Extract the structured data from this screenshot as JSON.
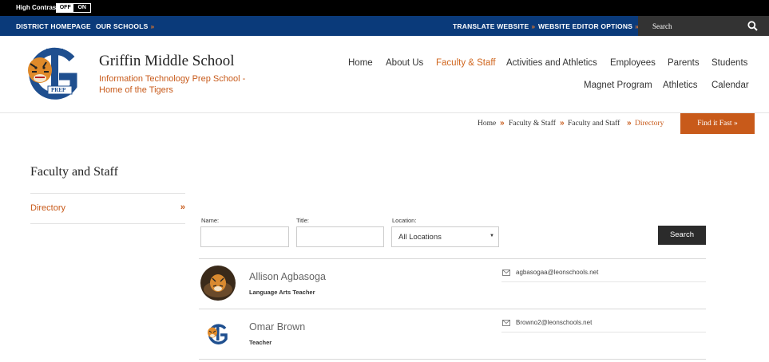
{
  "high_contrast": {
    "label": "High Contrast",
    "off": "OFF",
    "on": "ON"
  },
  "utility": {
    "district_homepage": "DISTRICT HOMEPAGE",
    "our_schools": "OUR SCHOOLS",
    "translate": "TRANSLATE WEBSITE",
    "editor_options": "WEBSITE EDITOR OPTIONS",
    "arrow": "»",
    "search_placeholder": "Search"
  },
  "header": {
    "school_name": "Griffin Middle School",
    "tagline": "Information Technology Prep School - Home of the Tigers",
    "logo_text": "PREP"
  },
  "nav": [
    {
      "label": "Home",
      "active": false
    },
    {
      "label": "About Us",
      "active": false
    },
    {
      "label": "Faculty & Staff",
      "active": true
    },
    {
      "label": "Activities and Athletics",
      "active": false
    },
    {
      "label": "Employees",
      "active": false
    },
    {
      "label": "Parents",
      "active": false
    },
    {
      "label": "Students",
      "active": false
    },
    {
      "label": "Magnet Program",
      "active": false
    },
    {
      "label": "Athletics",
      "active": false
    },
    {
      "label": "Calendar",
      "active": false
    }
  ],
  "breadcrumb": [
    "Home",
    "Faculty & Staff",
    "Faculty and Staff",
    "Directory"
  ],
  "breadcrumb_sep": "»",
  "find_it_fast": "Find it Fast »",
  "sidebar": {
    "title": "Faculty and Staff",
    "items": [
      {
        "label": "Directory",
        "arrow": "»"
      }
    ]
  },
  "form": {
    "name_label": "Name:",
    "title_label": "Title:",
    "location_label": "Location:",
    "location_value": "All Locations",
    "caret": "▼",
    "search_button": "Search"
  },
  "directory": [
    {
      "name": "Allison Agbasoga",
      "title": "Language Arts Teacher",
      "email": "agbasogaa@leonschools.net"
    },
    {
      "name": "Omar Brown",
      "title": "Teacher",
      "email": "Browno2@leonschools.net"
    }
  ],
  "colors": {
    "accent": "#c85a1a",
    "utility_bar": "#0a3a7a",
    "dark_button": "#2b2b2b"
  }
}
